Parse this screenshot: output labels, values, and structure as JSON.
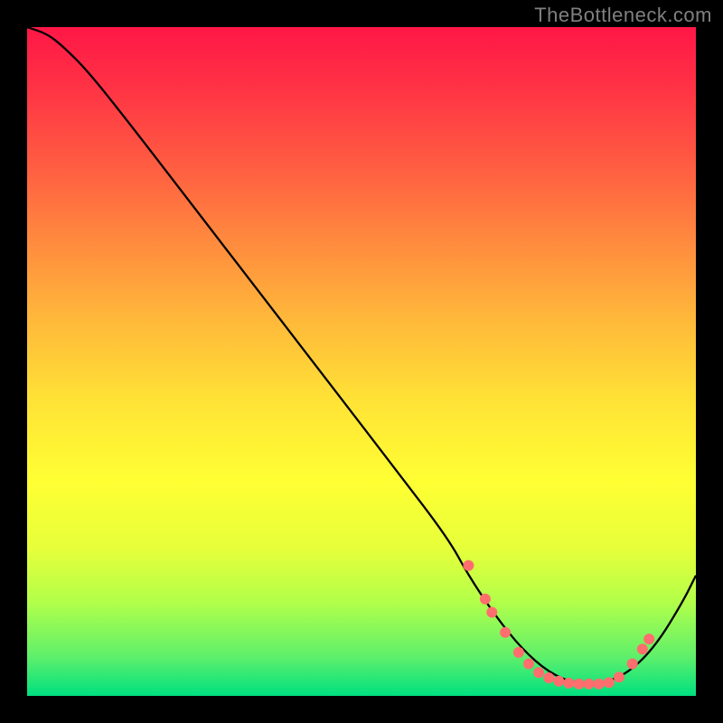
{
  "watermark": "TheBottleneck.com",
  "chart_data": {
    "type": "line",
    "title": "",
    "xlabel": "",
    "ylabel": "",
    "xlim": [
      0,
      1
    ],
    "ylim": [
      0,
      1
    ],
    "curve": {
      "x": [
        0.0,
        0.03,
        0.055,
        0.09,
        0.15,
        0.25,
        0.35,
        0.45,
        0.55,
        0.63,
        0.66,
        0.7,
        0.74,
        0.78,
        0.82,
        0.86,
        0.9,
        0.94,
        0.98,
        1.0
      ],
      "y": [
        1.0,
        0.99,
        0.97,
        0.935,
        0.86,
        0.73,
        0.6,
        0.47,
        0.34,
        0.235,
        0.18,
        0.12,
        0.07,
        0.035,
        0.018,
        0.018,
        0.035,
        0.075,
        0.14,
        0.18
      ]
    },
    "markers": {
      "x": [
        0.66,
        0.685,
        0.695,
        0.715,
        0.735,
        0.75,
        0.765,
        0.78,
        0.795,
        0.81,
        0.825,
        0.84,
        0.855,
        0.87,
        0.885,
        0.905,
        0.92,
        0.93
      ],
      "y": [
        0.195,
        0.145,
        0.125,
        0.095,
        0.065,
        0.048,
        0.035,
        0.027,
        0.022,
        0.019,
        0.018,
        0.018,
        0.018,
        0.02,
        0.028,
        0.048,
        0.07,
        0.085
      ]
    },
    "gradient_stops": [
      {
        "pos": 0.0,
        "color": "#ff1746"
      },
      {
        "pos": 0.5,
        "color": "#ffe336"
      },
      {
        "pos": 0.85,
        "color": "#b2ff4a"
      },
      {
        "pos": 1.0,
        "color": "#00e080"
      }
    ]
  }
}
